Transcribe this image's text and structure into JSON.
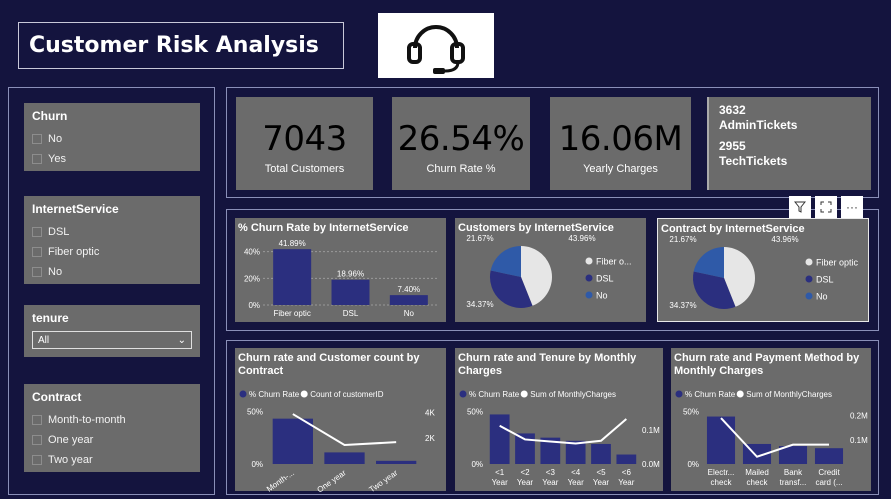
{
  "header": {
    "title": "Customer Risk Analysis",
    "logo_icon": "headset-icon"
  },
  "slicers": {
    "churn": {
      "title": "Churn",
      "options": [
        "No",
        "Yes"
      ]
    },
    "internet": {
      "title": "InternetService",
      "options": [
        "DSL",
        "Fiber optic",
        "No"
      ]
    },
    "tenure": {
      "title": "tenure",
      "selected": "All"
    },
    "contract": {
      "title": "Contract",
      "options": [
        "Month-to-month",
        "One year",
        "Two year"
      ]
    }
  },
  "kpis": [
    {
      "value": "7043",
      "label": "Total Customers"
    },
    {
      "value": "26.54%",
      "label": "Churn Rate %"
    },
    {
      "value": "16.06M",
      "label": "Yearly Charges"
    }
  ],
  "tickets": {
    "admin_value": "3632",
    "admin_label": "AdminTickets",
    "tech_value": "2955",
    "tech_label": "TechTickets"
  },
  "toolbar": {
    "filter_icon": "filter-icon",
    "focus_icon": "focus-mode-icon",
    "more_icon": "more-options-icon",
    "more_label": "···"
  },
  "colors": {
    "navy": "#2b2f7f",
    "blue": "#2f5aa8",
    "white": "#ffffff",
    "card": "#6b6b6b",
    "bg": "#14143e"
  },
  "chart_data": [
    {
      "type": "bar",
      "title": "% Churn Rate by InternetService",
      "categories": [
        "Fiber optic",
        "DSL",
        "No"
      ],
      "values": [
        41.89,
        18.96,
        7.4
      ],
      "data_labels": [
        "41.89%",
        "18.96%",
        "7.40%"
      ],
      "yticks": [
        "40%",
        "20%",
        "0%"
      ],
      "ylim": [
        0,
        45
      ]
    },
    {
      "type": "pie",
      "title": "Customers by InternetService",
      "slices": [
        {
          "name": "Fiber o...",
          "value": 43.96,
          "label": "43.96%",
          "color": "#e6e6e6"
        },
        {
          "name": "DSL",
          "value": 34.37,
          "label": "34.37%",
          "color": "#2b2f7f"
        },
        {
          "name": "No",
          "value": 21.67,
          "label": "21.67%",
          "color": "#2f5aa8"
        }
      ]
    },
    {
      "type": "pie",
      "title": "Contract by InternetService",
      "slices": [
        {
          "name": "Fiber optic",
          "value": 43.96,
          "label": "43.96%",
          "color": "#e6e6e6"
        },
        {
          "name": "DSL",
          "value": 34.37,
          "label": "34.37%",
          "color": "#2b2f7f"
        },
        {
          "name": "No",
          "value": 21.67,
          "label": "21.67%",
          "color": "#2f5aa8"
        }
      ]
    },
    {
      "type": "bar+line",
      "title": "Churn rate and Customer count by Contract",
      "legend": [
        "% Churn Rate",
        "Count of customerID"
      ],
      "categories": [
        "Month-...",
        "One year",
        "Two year"
      ],
      "bars": [
        43,
        11,
        3
      ],
      "line": [
        3875,
        1473,
        1695
      ],
      "yticks_left": [
        "50%",
        "0%"
      ],
      "yticks_right": [
        "4K",
        "2K"
      ],
      "ylim_left": [
        0,
        55
      ],
      "ylim_right": [
        0,
        4500
      ]
    },
    {
      "type": "bar+line",
      "title": "Churn rate and Tenure by Monthly Charges",
      "legend": [
        "% Churn Rate",
        "Sum of MonthlyCharges"
      ],
      "categories": [
        "<1 Year",
        "<2 Year",
        "<3 Year",
        "<4 Year",
        "<5 Year",
        "<6 Year"
      ],
      "bars": [
        47,
        29,
        25,
        22,
        19,
        9
      ],
      "line": [
        0.112,
        0.072,
        0.066,
        0.06,
        0.068,
        0.132
      ],
      "yticks_left": [
        "50%",
        "0%"
      ],
      "yticks_right": [
        "0.1M",
        "0.0M"
      ],
      "ylim_left": [
        0,
        55
      ],
      "ylim_right": [
        0,
        0.17
      ]
    },
    {
      "type": "bar+line",
      "title": "Churn rate and Payment Method by Monthly Charges",
      "legend": [
        "% Churn Rate",
        "Sum of MonthlyCharges"
      ],
      "categories": [
        "Electr... check",
        "Mailed check",
        "Bank transf...",
        "Credit card (..."
      ],
      "bars": [
        45,
        19,
        17,
        15
      ],
      "line": [
        0.19,
        0.03,
        0.08,
        0.08
      ],
      "yticks_left": [
        "50%",
        "0%"
      ],
      "yticks_right": [
        "0.2M",
        "0.1M"
      ],
      "ylim_left": [
        0,
        55
      ],
      "ylim_right": [
        0,
        0.24
      ]
    }
  ]
}
